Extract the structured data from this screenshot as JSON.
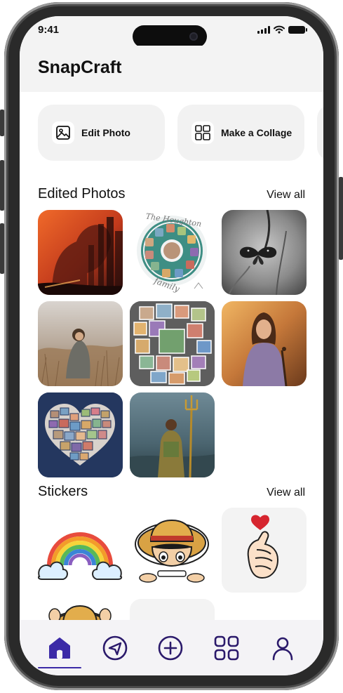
{
  "status_bar": {
    "time": "9:41"
  },
  "app": {
    "title": "SnapCraft"
  },
  "quick_actions": [
    {
      "label": "Edit Photo",
      "icon": "image-icon"
    },
    {
      "label": "Make a Collage",
      "icon": "grid-icon"
    }
  ],
  "edited_photos": {
    "title": "Edited Photos",
    "view_all": "View all",
    "items": [
      {
        "name": "double-exposure-portrait"
      },
      {
        "name": "family-circle-collage",
        "text": "The Houghton family"
      },
      {
        "name": "butterfly-on-flower"
      },
      {
        "name": "woman-in-field"
      },
      {
        "name": "photo-grid-collage"
      },
      {
        "name": "woman-in-purple-dress"
      },
      {
        "name": "heart-collage"
      },
      {
        "name": "aquaman-trident"
      }
    ]
  },
  "stickers": {
    "title": "Stickers",
    "view_all": "View all",
    "items": [
      {
        "name": "rainbow-sticker"
      },
      {
        "name": "luffy-peeking-sticker"
      },
      {
        "name": "finger-heart-sticker"
      },
      {
        "name": "luffy-partial-sticker"
      },
      {
        "name": "blank-sticker"
      }
    ]
  },
  "bottom_nav": [
    {
      "name": "home",
      "icon": "home-icon",
      "active": true
    },
    {
      "name": "explore",
      "icon": "send-icon",
      "active": false
    },
    {
      "name": "create",
      "icon": "plus-circle-icon",
      "active": false
    },
    {
      "name": "apps",
      "icon": "grid-icon",
      "active": false
    },
    {
      "name": "profile",
      "icon": "user-icon",
      "active": false
    }
  ],
  "colors": {
    "accent": "#3b2aa7",
    "nav_icon": "#2b1a6b",
    "surface": "#f3f3f3"
  }
}
